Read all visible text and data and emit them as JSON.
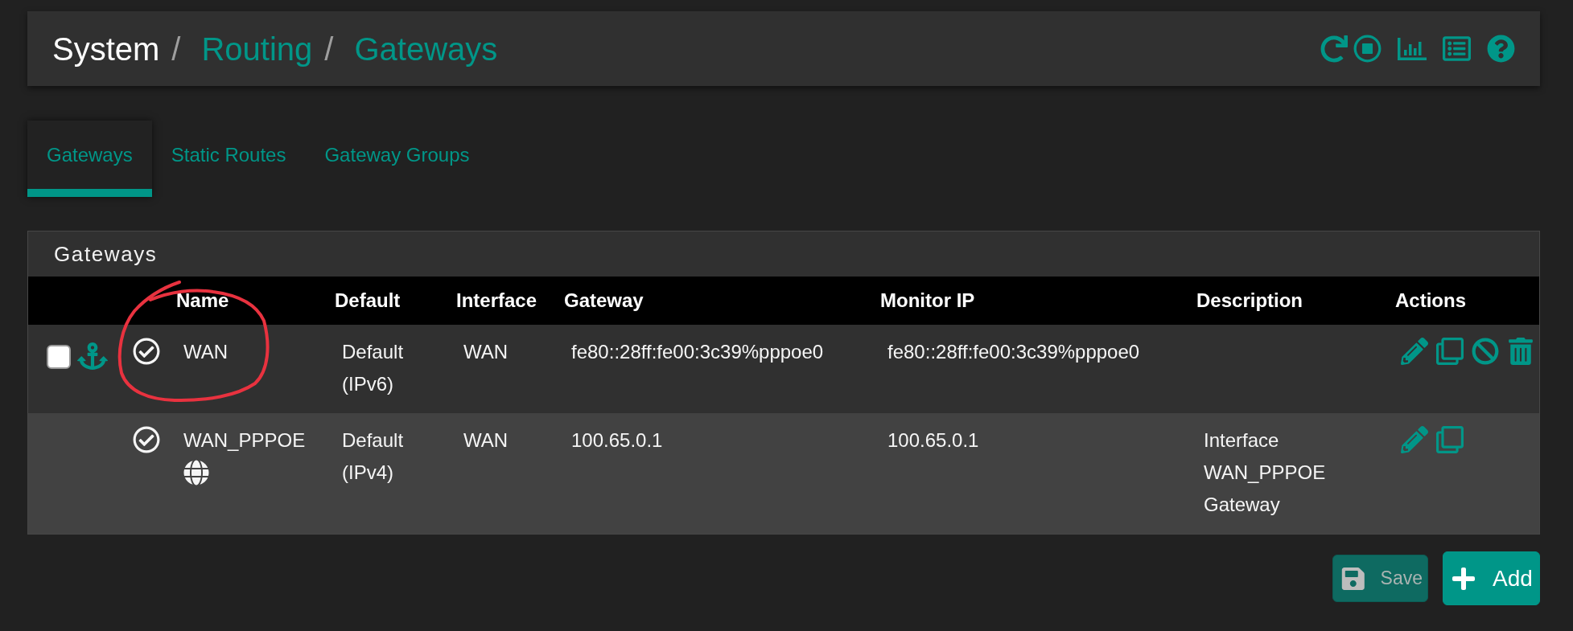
{
  "header": {
    "breadcrumb": [
      {
        "label": "System",
        "link": false
      },
      {
        "label": "Routing",
        "link": true
      },
      {
        "label": "Gateways",
        "link": true
      }
    ],
    "separator": "/"
  },
  "tabs": [
    {
      "label": "Gateways",
      "selected": true
    },
    {
      "label": "Static Routes",
      "selected": false
    },
    {
      "label": "Gateway Groups",
      "selected": false
    }
  ],
  "panel": {
    "title": "Gateways",
    "table": {
      "columns": [
        "Name",
        "Default",
        "Interface",
        "Gateway",
        "Monitor IP",
        "Description",
        "Actions"
      ],
      "rows": [
        {
          "checkbox": {
            "checked": false
          },
          "anchor": true,
          "active": true,
          "name": "WAN",
          "globe": false,
          "default": "Default (IPv6)",
          "interface": "WAN",
          "gateway": "fe80::28ff:fe00:3c39%pppoe0",
          "monitor_ip": "fe80::28ff:fe00:3c39%pppoe0",
          "actions": [
            {
              "kind": "edit"
            },
            {
              "kind": "copy"
            },
            {
              "kind": "disable"
            },
            {
              "kind": "delete"
            }
          ]
        },
        {
          "anchor": false,
          "active": true,
          "name": "WAN_PPPOE",
          "globe": true,
          "default": "Default (IPv4)",
          "interface": "WAN",
          "gateway": "100.65.0.1",
          "monitor_ip": "100.65.0.1",
          "description": "Interface WAN_PPPOE Gateway",
          "actions": [
            {
              "kind": "edit"
            },
            {
              "kind": "copy"
            }
          ]
        }
      ]
    }
  },
  "annotation": {
    "kind": "hand-drawn-circle"
  },
  "buttons": [
    {
      "label": "Save",
      "kind": "save",
      "disabled": true
    },
    {
      "label": "Add",
      "kind": "add",
      "disabled": false
    }
  ]
}
